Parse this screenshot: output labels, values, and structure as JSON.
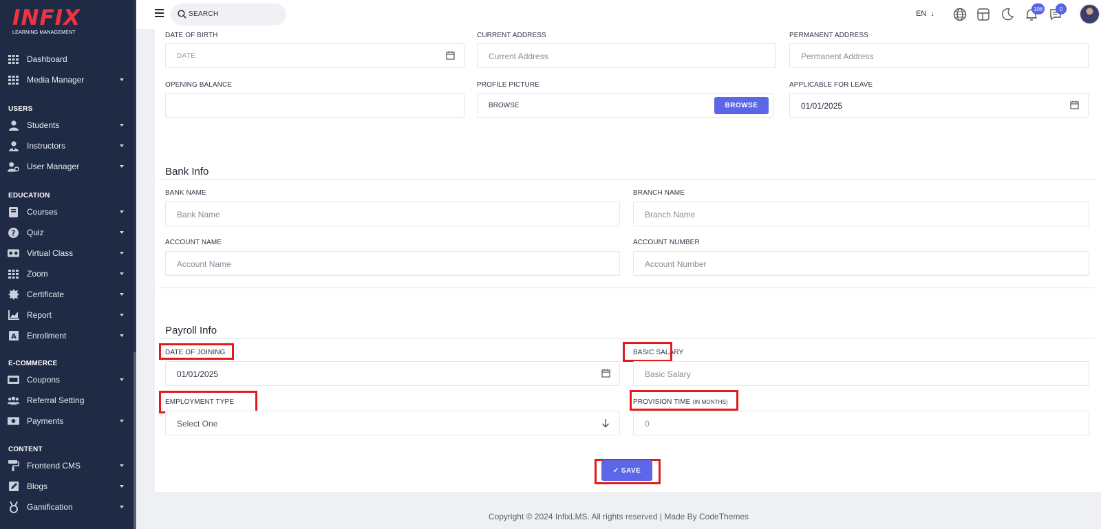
{
  "brand": {
    "logo_text": "INFIX",
    "tagline": "LEARNING MANAGEMENT"
  },
  "sidebar": {
    "top_items": [
      {
        "label": "Dashboard",
        "icon": "grid-icon",
        "has_caret": false
      },
      {
        "label": "Media Manager",
        "icon": "grid-icon",
        "has_caret": true
      }
    ],
    "sections": [
      {
        "title": "USERS",
        "items": [
          {
            "label": "Students",
            "icon": "user-icon"
          },
          {
            "label": "Instructors",
            "icon": "instructor-icon"
          },
          {
            "label": "User Manager",
            "icon": "user-gear-icon"
          }
        ]
      },
      {
        "title": "EDUCATION",
        "items": [
          {
            "label": "Courses",
            "icon": "book-icon"
          },
          {
            "label": "Quiz",
            "icon": "question-icon"
          },
          {
            "label": "Virtual Class",
            "icon": "vr-icon"
          },
          {
            "label": "Zoom",
            "icon": "grid-icon"
          },
          {
            "label": "Certificate",
            "icon": "certificate-icon"
          },
          {
            "label": "Report",
            "icon": "chart-icon"
          },
          {
            "label": "Enrollment",
            "icon": "enrollment-icon"
          }
        ]
      },
      {
        "title": "E-COMMERCE",
        "items": [
          {
            "label": "Coupons",
            "icon": "coupon-icon"
          },
          {
            "label": "Referral Setting",
            "icon": "users-icon"
          },
          {
            "label": "Payments",
            "icon": "money-icon"
          }
        ]
      },
      {
        "title": "CONTENT",
        "items": [
          {
            "label": "Frontend CMS",
            "icon": "paint-roller-icon"
          },
          {
            "label": "Blogs",
            "icon": "edit-icon"
          },
          {
            "label": "Gamification",
            "icon": "medal-icon"
          }
        ]
      }
    ]
  },
  "topbar": {
    "search_placeholder": "SEARCH",
    "language": "EN",
    "notifications_count": "106",
    "messages_count": "0"
  },
  "form": {
    "date_of_birth": {
      "label": "DATE OF BIRTH",
      "placeholder": "DATE"
    },
    "current_address": {
      "label": "CURRENT ADDRESS",
      "placeholder": "Current Address"
    },
    "permanent_address": {
      "label": "PERMANENT ADDRESS",
      "placeholder": "Permanent Address"
    },
    "opening_balance": {
      "label": "OPENING BALANCE",
      "value": ""
    },
    "profile_picture": {
      "label": "PROFILE PICTURE",
      "value": "BROWSE",
      "button": "BROWSE"
    },
    "applicable_for_leave": {
      "label": "APPLICABLE FOR LEAVE",
      "value": "01/01/2025"
    }
  },
  "bank_info": {
    "title": "Bank Info",
    "bank_name": {
      "label": "BANK NAME",
      "placeholder": "Bank Name"
    },
    "branch_name": {
      "label": "BRANCH NAME",
      "placeholder": "Branch Name"
    },
    "account_name": {
      "label": "ACCOUNT NAME",
      "placeholder": "Account Name"
    },
    "account_number": {
      "label": "ACCOUNT NUMBER",
      "placeholder": "Account Number"
    }
  },
  "payroll_info": {
    "title": "Payroll Info",
    "date_of_joining": {
      "label": "DATE OF JOINING",
      "value": "01/01/2025"
    },
    "basic_salary": {
      "label": "BASIC SALARY",
      "placeholder": "Basic Salary"
    },
    "employment_type": {
      "label": "EMPLOYMENT TYPE",
      "value": "Select One"
    },
    "provision_time": {
      "label": "PROVISION TIME",
      "label_suffix": "(IN MONTHS)",
      "value": "0"
    }
  },
  "save_button": "SAVE",
  "footer": "Copyright © 2024 InfixLMS. All rights reserved | Made By CodeThemes",
  "colors": {
    "sidebar_bg": "#1f2a44",
    "accent": "#5b67e6",
    "highlight": "#e21a1a",
    "logo_red": "#ef3340"
  }
}
